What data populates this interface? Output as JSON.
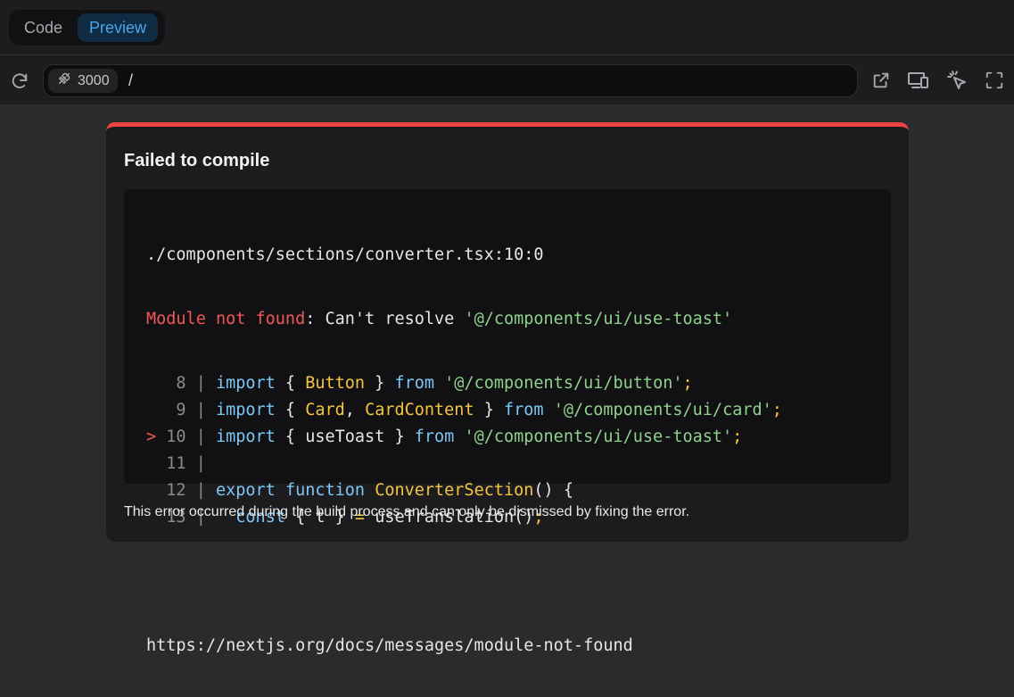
{
  "tabs": [
    {
      "label": "Code",
      "active": false
    },
    {
      "label": "Preview",
      "active": true
    }
  ],
  "urlbar": {
    "port": "3000",
    "path": "/"
  },
  "error": {
    "title": "Failed to compile",
    "file": "./components/sections/converter.tsx:10:0",
    "message_label": "Module not found",
    "message_text": ": Can't resolve ",
    "message_module": "'@/components/ui/use-toast'",
    "code_lines": [
      {
        "marker": " ",
        "number": "8",
        "parts": [
          [
            "kw",
            "import"
          ],
          [
            "plain",
            " { "
          ],
          [
            "typ",
            "Button"
          ],
          [
            "plain",
            " } "
          ],
          [
            "kw",
            "from"
          ],
          [
            "plain",
            " "
          ],
          [
            "str",
            "'@/components/ui/button'"
          ],
          [
            "op",
            ";"
          ]
        ]
      },
      {
        "marker": " ",
        "number": "9",
        "parts": [
          [
            "kw",
            "import"
          ],
          [
            "plain",
            " { "
          ],
          [
            "typ",
            "Card"
          ],
          [
            "plain",
            ", "
          ],
          [
            "typ",
            "CardContent"
          ],
          [
            "plain",
            " } "
          ],
          [
            "kw",
            "from"
          ],
          [
            "plain",
            " "
          ],
          [
            "str",
            "'@/components/ui/card'"
          ],
          [
            "op",
            ";"
          ]
        ]
      },
      {
        "marker": ">",
        "number": "10",
        "parts": [
          [
            "kw",
            "import"
          ],
          [
            "plain",
            " { useToast } "
          ],
          [
            "kw",
            "from"
          ],
          [
            "plain",
            " "
          ],
          [
            "str",
            "'@/components/ui/use-toast'"
          ],
          [
            "op",
            ";"
          ]
        ]
      },
      {
        "marker": " ",
        "number": "11",
        "parts": []
      },
      {
        "marker": " ",
        "number": "12",
        "parts": [
          [
            "kw",
            "export"
          ],
          [
            "plain",
            " "
          ],
          [
            "kw",
            "function"
          ],
          [
            "plain",
            " "
          ],
          [
            "fn",
            "ConverterSection"
          ],
          [
            "plain",
            "() {"
          ]
        ]
      },
      {
        "marker": " ",
        "number": "13",
        "parts": [
          [
            "plain",
            "  "
          ],
          [
            "kw",
            "const"
          ],
          [
            "plain",
            " { t } "
          ],
          [
            "op",
            "="
          ],
          [
            "plain",
            " useTranslation()"
          ],
          [
            "op",
            ";"
          ]
        ]
      }
    ],
    "link": "https://nextjs.org/docs/messages/module-not-found",
    "footer": "This error occurred during the build process and can only be dismissed by fixing the error."
  },
  "colors": {
    "accent": "#4aa3ea",
    "error": "#ef4444",
    "keyword": "#7cc7f5",
    "string": "#8fd18c",
    "type": "#f4c542"
  },
  "icons": [
    "refresh-icon",
    "plug-icon",
    "external-link-icon",
    "responsive-devices-icon",
    "pointer-select-icon",
    "fullscreen-icon"
  ]
}
